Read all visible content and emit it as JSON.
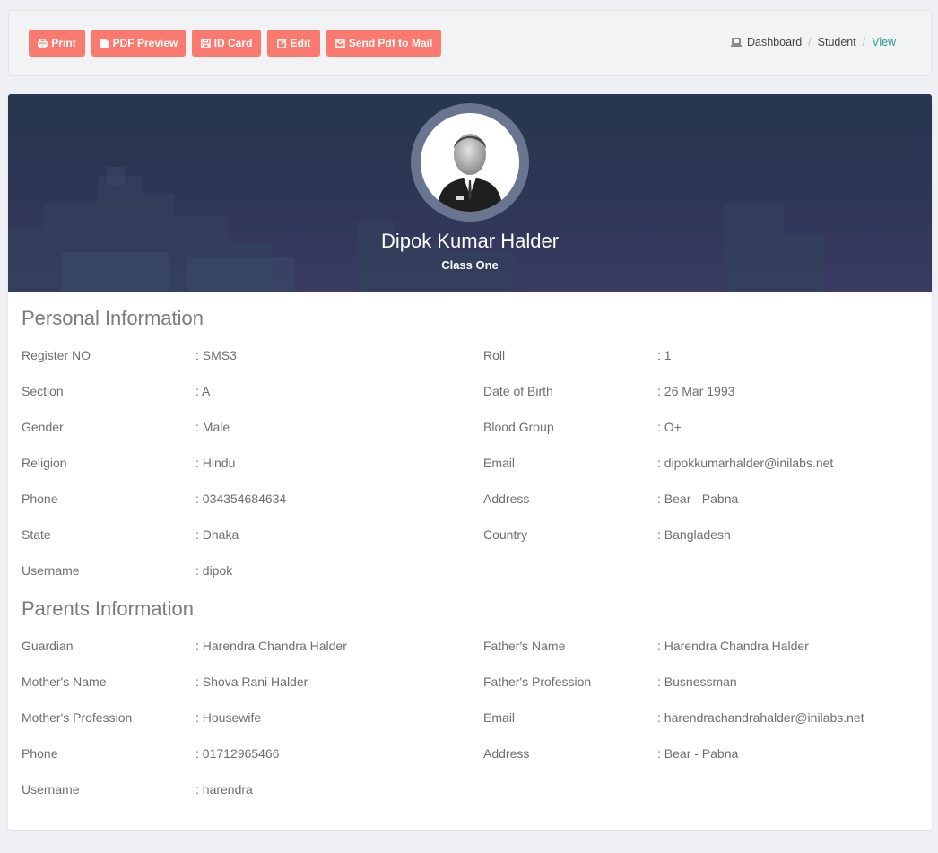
{
  "toolbar": {
    "buttons": [
      {
        "label": "Print",
        "icon": "print-icon"
      },
      {
        "label": "PDF Preview",
        "icon": "file-icon"
      },
      {
        "label": "ID Card",
        "icon": "floppy-icon"
      },
      {
        "label": "Edit",
        "icon": "edit-icon"
      },
      {
        "label": "Send Pdf to Mail",
        "icon": "envelope-icon"
      }
    ],
    "accent_color": "#fb7a6f"
  },
  "breadcrumb": {
    "items": [
      "Dashboard",
      "Student",
      "View"
    ],
    "active_color": "#2a9d8f"
  },
  "profile": {
    "name": "Dipok Kumar Halder",
    "class": "Class One"
  },
  "personal": {
    "title": "Personal Information",
    "fields": [
      {
        "label": "Register NO",
        "value": ": SMS3"
      },
      {
        "label": "Roll",
        "value": ": 1"
      },
      {
        "label": "Section",
        "value": ": A"
      },
      {
        "label": "Date of Birth",
        "value": ": 26 Mar 1993"
      },
      {
        "label": "Gender",
        "value": ": Male"
      },
      {
        "label": "Blood Group",
        "value": ": O+"
      },
      {
        "label": "Religion",
        "value": ": Hindu"
      },
      {
        "label": "Email",
        "value": ": dipokkumarhalder@inilabs.net"
      },
      {
        "label": "Phone",
        "value": ": 034354684634"
      },
      {
        "label": "Address",
        "value": ": Bear - Pabna"
      },
      {
        "label": "State",
        "value": ": Dhaka"
      },
      {
        "label": "Country",
        "value": ": Bangladesh"
      },
      {
        "label": "Username",
        "value": ": dipok"
      }
    ]
  },
  "parents": {
    "title": "Parents Information",
    "fields": [
      {
        "label": "Guardian",
        "value": ": Harendra Chandra Halder"
      },
      {
        "label": "Father's Name",
        "value": ": Harendra Chandra Halder"
      },
      {
        "label": "Mother's Name",
        "value": ": Shova Rani Halder"
      },
      {
        "label": "Father's Profession",
        "value": ": Busnessman"
      },
      {
        "label": "Mother's Profession",
        "value": ": Housewife"
      },
      {
        "label": "Email",
        "value": ": harendrachandrahalder@inilabs.net"
      },
      {
        "label": "Phone",
        "value": ": 01712965466"
      },
      {
        "label": "Address",
        "value": ": Bear - Pabna"
      },
      {
        "label": "Username",
        "value": ": harendra"
      }
    ]
  }
}
